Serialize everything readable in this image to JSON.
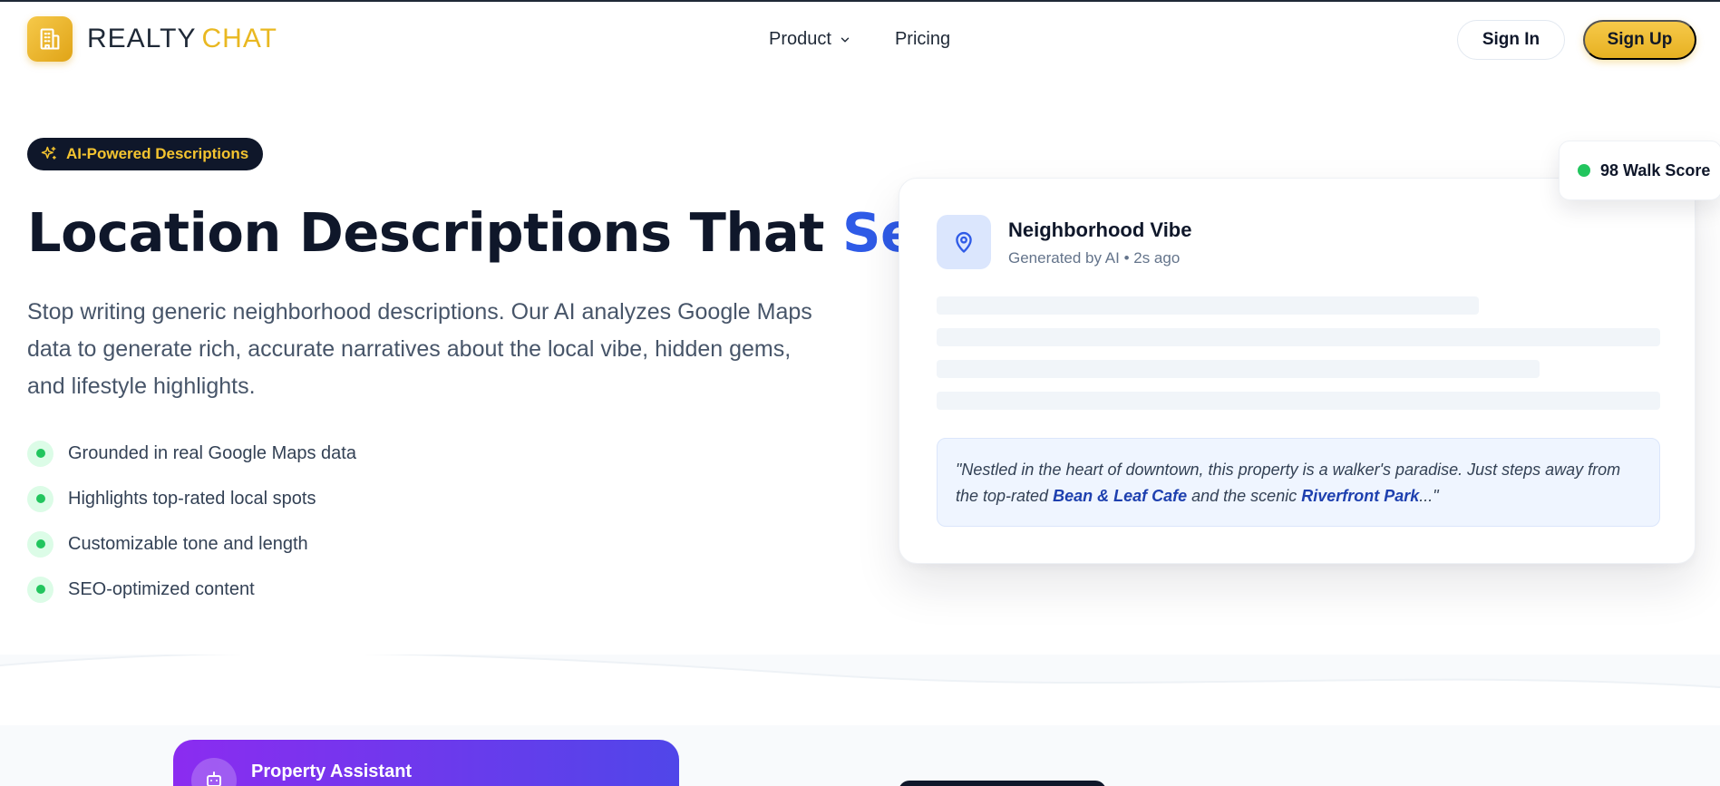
{
  "brand": {
    "word1": "REALTY",
    "word2": "CHAT"
  },
  "nav": {
    "product": "Product",
    "pricing": "Pricing"
  },
  "auth": {
    "signin": "Sign In",
    "signup": "Sign Up"
  },
  "hero": {
    "badge": "AI-Powered Descriptions",
    "title_main": "Location Descriptions That ",
    "title_accent": "Sell",
    "description": "Stop writing generic neighborhood descriptions. Our AI analyzes Google Maps data to generate rich, accurate narratives about the local vibe, hidden gems, and lifestyle highlights.",
    "features": [
      "Grounded in real Google Maps data",
      "Highlights top-rated local spots",
      "Customizable tone and length",
      "SEO-optimized content"
    ]
  },
  "card": {
    "title": "Neighborhood Vibe",
    "subtitle": "Generated by AI • 2s ago",
    "quote_part1": "\"Nestled in the heart of downtown, this property is a walker's paradise. Just steps away from the top-rated ",
    "quote_place1": "Bean & Leaf Cafe",
    "quote_part2": " and the scenic ",
    "quote_place2": "Riverfront Park",
    "quote_part3": "...\""
  },
  "walk_score": "98 Walk Score",
  "assistant": {
    "title": "Property Assistant"
  },
  "colors": {
    "accent_blue": "#2f5be7",
    "brand_gold": "#e9b821",
    "dark": "#0f172a",
    "green": "#22c55e"
  }
}
